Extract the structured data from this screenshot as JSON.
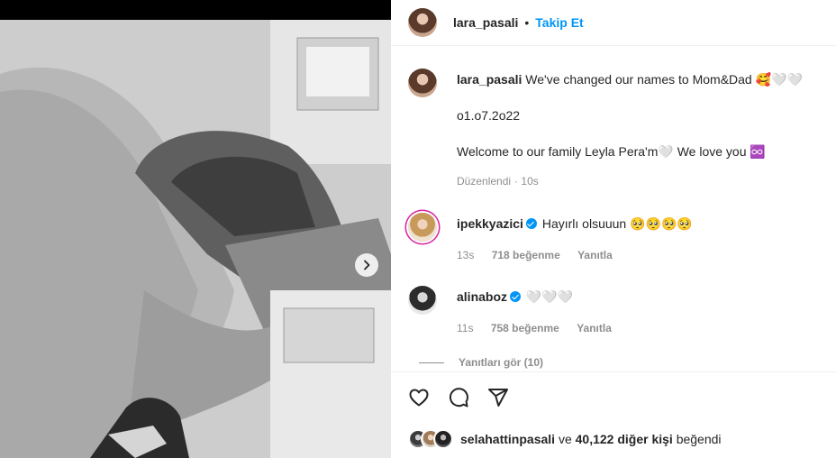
{
  "header": {
    "username": "lara_pasali",
    "dot": "•",
    "follow_label": "Takip Et"
  },
  "caption": {
    "username": "lara_pasali",
    "line1": "We've changed our names to Mom&Dad 🥰🤍🤍",
    "line2": "o1.o7.2o22",
    "line3": "Welcome to our family Leyla Pera'm🤍 We love you ♾️",
    "edited": "Düzenlendi",
    "time": "10s"
  },
  "comments": [
    {
      "username": "ipekkyazici",
      "text": "Hayırlı olsuuun 🥺🥺🥺🥺",
      "time": "13s",
      "likes": "718 beğenme",
      "reply": "Yanıtla"
    },
    {
      "username": "alinaboz",
      "text": "🤍🤍🤍",
      "time": "11s",
      "likes": "758 beğenme",
      "reply": "Yanıtla"
    }
  ],
  "view_replies": "Yanıtları gör (10)",
  "actions": {
    "like": "heart-icon",
    "comment": "comment-icon",
    "share": "share-icon"
  },
  "likes_line": {
    "user": "selahattinpasali",
    "connector": "ve",
    "count": "40,122 diğer kişi",
    "suffix": "beğendi"
  },
  "colors": {
    "accent": "#0095f6",
    "text": "#262626",
    "muted": "#8e8e8e"
  }
}
